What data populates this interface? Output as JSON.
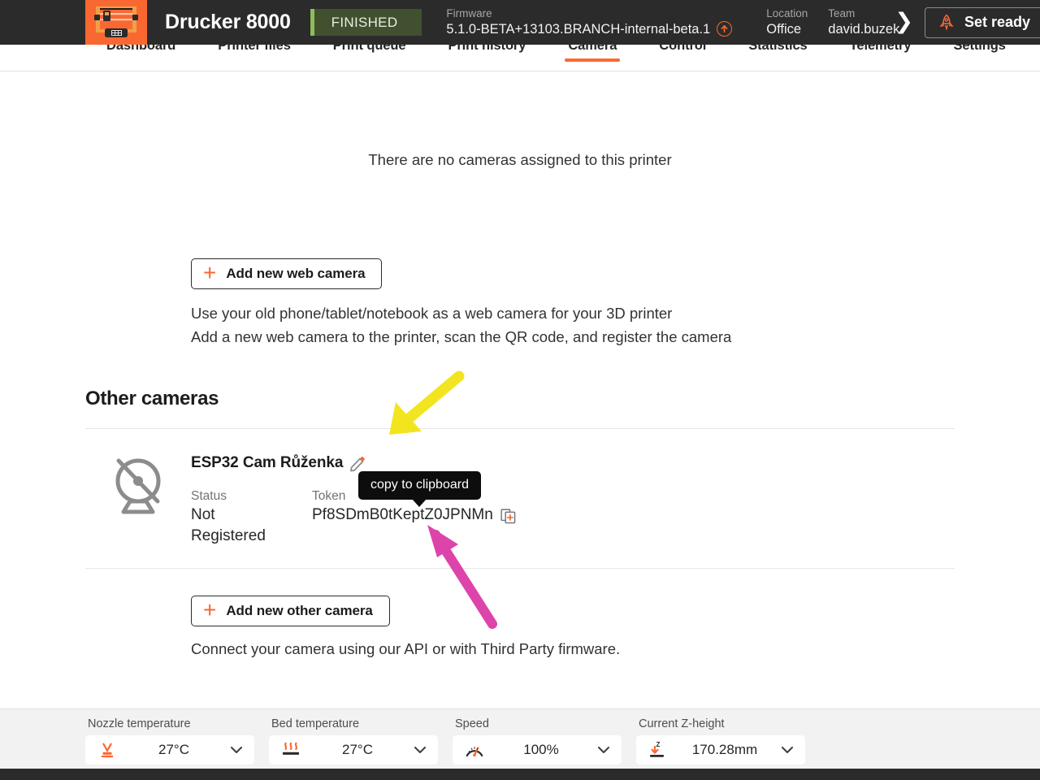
{
  "header": {
    "logo_icon": "3d-printer-icon",
    "printer_name": "Drucker 8000",
    "status": "FINISHED",
    "firmware_label": "Firmware",
    "firmware_version": "5.1.0-BETA+13103.BRANCH-internal-beta.1",
    "firmware_update_icon": "arrow-up-circle-icon",
    "location_label": "Location",
    "location_value": "Office",
    "team_label": "Team",
    "team_value": "david.buzek",
    "expand_icon": "chevron-right-icon",
    "set_ready_icon": "rocket-icon",
    "set_ready_label": "Set ready",
    "accent_color": "#fa6831",
    "bar_color": "#2b2b2b",
    "status_bg": "#41502f",
    "status_accent": "#8fbc5a"
  },
  "nav": {
    "items": [
      {
        "label": "Dashboard",
        "active": false
      },
      {
        "label": "Printer files",
        "active": false
      },
      {
        "label": "Print queue",
        "active": false
      },
      {
        "label": "Print history",
        "active": false
      },
      {
        "label": "Camera",
        "active": true
      },
      {
        "label": "Control",
        "active": false
      },
      {
        "label": "Statistics",
        "active": false
      },
      {
        "label": "Telemetry",
        "active": false
      },
      {
        "label": "Settings",
        "active": false
      }
    ]
  },
  "main": {
    "empty_message": "There are no cameras assigned to this printer",
    "add_web_camera_label": "Add new web camera",
    "add_icon": "plus-icon",
    "help_line_1": "Use your old phone/tablet/notebook as a web camera for your 3D printer",
    "help_line_2": "Add a new web camera to the printer, scan the QR code, and register the camera",
    "other_cameras_title": "Other cameras",
    "camera": {
      "icon": "camera-off-icon",
      "name": "ESP32 Cam Růženka",
      "edit_icon": "pencil-icon",
      "status_label": "Status",
      "status_value": "Not Registered",
      "token_label": "Token",
      "token_value": "Pf8SDmB0tKeptZ0JPNMn",
      "copy_icon": "copy-icon"
    },
    "tooltip_text": "copy to clipboard",
    "add_other_camera_label": "Add new other camera",
    "help_line_3": "Connect your camera using our API or with Third Party firmware."
  },
  "bottom_bar": {
    "items": [
      {
        "label": "Nozzle temperature",
        "value": "27°C",
        "icon": "nozzle-icon"
      },
      {
        "label": "Bed temperature",
        "value": "27°C",
        "icon": "heatbed-icon"
      },
      {
        "label": "Speed",
        "value": "100%",
        "icon": "speedometer-icon"
      },
      {
        "label": "Current Z-height",
        "value": "170.28mm",
        "icon": "z-height-icon"
      }
    ],
    "chevron_icon": "chevron-down-icon"
  }
}
